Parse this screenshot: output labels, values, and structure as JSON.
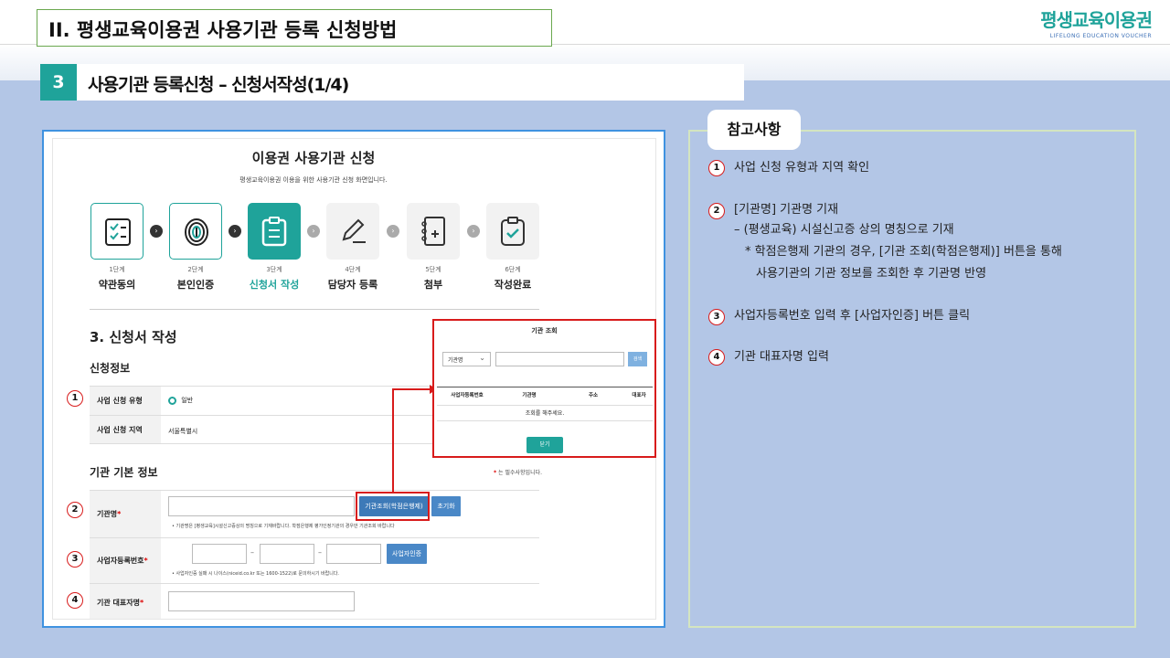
{
  "header": {
    "section_title": "II. 평생교육이용권 사용기관 등록 신청방법",
    "logo_main": "평생교육이용권",
    "logo_sub": "LIFELONG EDUCATION VOUCHER",
    "step_number": "3",
    "step_title": "사용기관 등록신청 – 신청서작성(1/4)"
  },
  "screenshot": {
    "title": "이용권 사용기관 신청",
    "subtitle": "평생교육이용권 이용을 위한 사용기관 신청 화면입니다.",
    "steps": [
      {
        "no": "1단계",
        "name": "약관동의"
      },
      {
        "no": "2단계",
        "name": "본인인증"
      },
      {
        "no": "3단계",
        "name": "신청서 작성"
      },
      {
        "no": "4단계",
        "name": "담당자 등록"
      },
      {
        "no": "5단계",
        "name": "첨부"
      },
      {
        "no": "6단계",
        "name": "작성완료"
      }
    ],
    "form_heading": "3. 신청서 작성",
    "app_info_title": "신청정보",
    "app_type_label": "사업 신청 유형",
    "app_type_value": "일반",
    "app_region_label": "사업 신청 지역",
    "app_region_value": "서울특별시",
    "basic_info_title": "기관 기본 정보",
    "required_note_mark": "*",
    "required_note": " 는 필수사항입니다.",
    "org_name_label": "기관명",
    "org_search_btn": "기관조회(학점은행제)",
    "reset_btn": "초기화",
    "org_name_hint": "• 기관명은 [평생교육]시설신고증상의 명칭으로 기재바랍니다. 학점은행제 평가인정기관의 경우만 기관조회 바랍니다",
    "biz_no_label": "사업자등록번호",
    "biz_cert_btn": "사업자인증",
    "biz_no_hint": "• 사업자인증 실패 시 나이스(niceid.co.kr 또는 1600-1522)로 문의하시기 바랍니다.",
    "rep_label": "기관 대표자명",
    "req_mark": "*",
    "dash": "–"
  },
  "popup": {
    "title": "기관 조회",
    "select_value": "기관명",
    "search_btn": "검색",
    "columns": [
      "사업자등록번호",
      "기관명",
      "주소",
      "대표자"
    ],
    "empty_text": "조회를 해주세요.",
    "close_btn": "닫기"
  },
  "markers": [
    "1",
    "2",
    "3",
    "4"
  ],
  "notes": {
    "tag": "참고사항",
    "items": [
      {
        "num": "1",
        "text": "사업 신청 유형과 지역 확인"
      },
      {
        "num": "2",
        "text": "[기관명] 기관명 기재",
        "sub1": "– (평생교육) 시설신고증 상의 명칭으로 기재",
        "sub2": "* 학점은행제 기관의 경우, [기관 조회(학점은행제)] 버튼을 통해",
        "sub3": "사용기관의 기관 정보를 조회한 후 기관명 반영"
      },
      {
        "num": "3",
        "text": "사업자등록번호 입력 후 [사업자인증] 버튼 클릭"
      },
      {
        "num": "4",
        "text": "기관 대표자명 입력"
      }
    ]
  },
  "colors": {
    "accent_teal": "#1fa39a",
    "marker_red": "#d81b1b",
    "frame_blue": "#3f92e0",
    "background": "#b3c6e6"
  }
}
